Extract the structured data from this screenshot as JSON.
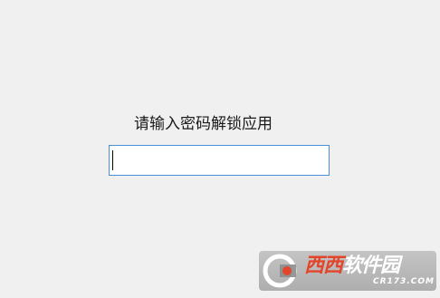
{
  "prompt": {
    "label": "请输入密码解锁应用"
  },
  "password_input": {
    "value": ""
  },
  "watermark": {
    "brand_red": "西西",
    "brand_white": "软件园",
    "domain": "CR173.COM"
  },
  "colors": {
    "background": "#f0f0f0",
    "input_border": "#4a90d9",
    "watermark_red": "#e3452b"
  }
}
